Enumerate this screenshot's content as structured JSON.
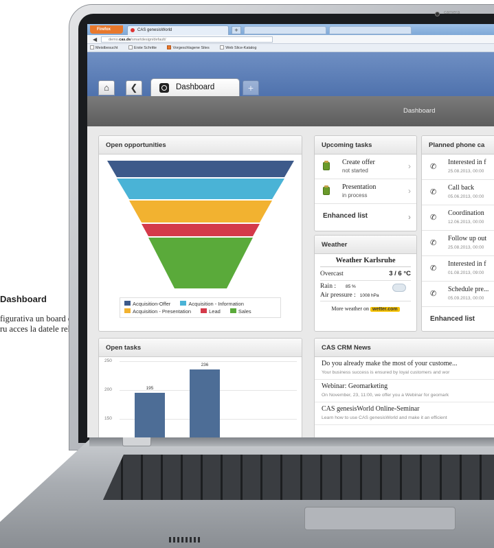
{
  "caption": {
    "title": "Dashboard",
    "text": "figurativa un board cutomizat ru acces la datele relevante."
  },
  "laptop": {
    "webcam_label": "camera"
  },
  "browser": {
    "firefox_label": "Firefox",
    "active_tab": "CAS genesisWorld",
    "new_tab": "+",
    "url_prefix": "demo.",
    "url_domain": "cas.de",
    "url_suffix": "/smartdesign/default/",
    "bookmarks": [
      "Meistbesucht",
      "Erste Schritte",
      "Vorgeschlagene Sites",
      "Web Slice-Katalog"
    ]
  },
  "app": {
    "nav_home": "⌂",
    "nav_back": "❮",
    "tab_label": "Dashboard",
    "plus_tab": "+",
    "page_title": "Dashboard"
  },
  "opportunities": {
    "title": "Open opportunities",
    "legend": [
      "Acquisition-Offer",
      "Acquisition - Information",
      "Acquisition - Presentation",
      "Lead",
      "Sales"
    ]
  },
  "upcoming": {
    "title": "Upcoming tasks",
    "items": [
      {
        "title": "Create offer",
        "status": "not started"
      },
      {
        "title": "Presentation",
        "status": "in process"
      }
    ],
    "enhanced_list": "Enhanced list"
  },
  "weather": {
    "title": "Weather",
    "location": "Weather Karlsruhe",
    "condition": "Overcast",
    "temp": "3 / 6 °C",
    "rain_label": "Rain :",
    "rain_value": "85 %",
    "pressure_label": "Air pressure :",
    "pressure_value": "1008 hPa",
    "more_text": "More weather on",
    "more_link": "wetter.com"
  },
  "calls": {
    "title": "Planned phone ca",
    "items": [
      {
        "title": "Interested in f",
        "date": "25.08.2013, 00:00"
      },
      {
        "title": "Call back",
        "date": "05.06.2013, 00:00"
      },
      {
        "title": "Coordination",
        "date": "12.06.2013, 00:00"
      },
      {
        "title": "Follow up out",
        "date": "25.08.2013, 00:00"
      },
      {
        "title": "Interested in f",
        "date": "01.08.2013, 09:00"
      },
      {
        "title": "Schedule pre...",
        "date": "05.09.2013, 00:00"
      }
    ],
    "enhanced_list": "Enhanced list"
  },
  "open_tasks": {
    "title": "Open tasks",
    "y_ticks": [
      "250",
      "200",
      "150"
    ]
  },
  "news": {
    "title": "CAS CRM News",
    "items": [
      {
        "title": "Do you already make the most of your custome...",
        "body": "Your business success is ensured by loyal customers and wor"
      },
      {
        "title": "Webinar: Geomarketing",
        "body": "On November, 23, 11:00, we offer you a Webinar for geomark"
      },
      {
        "title": "CAS genesisWorld Online-Seminar",
        "body": "Learn how to use CAS genesisWorld and make it an efficient"
      }
    ]
  },
  "chart_data": [
    {
      "type": "bar",
      "title": "Open tasks",
      "categories": [
        "",
        ""
      ],
      "values": [
        195,
        236
      ],
      "ylim": [
        150,
        250
      ],
      "colors": [
        "#4d6d96"
      ],
      "grid": true
    },
    {
      "type": "funnel",
      "title": "Open opportunities",
      "categories": [
        "Acquisition-Offer",
        "Acquisition - Information",
        "Acquisition - Presentation",
        "Lead",
        "Sales"
      ],
      "colors": [
        "#3d5a8a",
        "#4ab3d6",
        "#f2b230",
        "#d43a4a",
        "#5aaa3a"
      ]
    }
  ]
}
